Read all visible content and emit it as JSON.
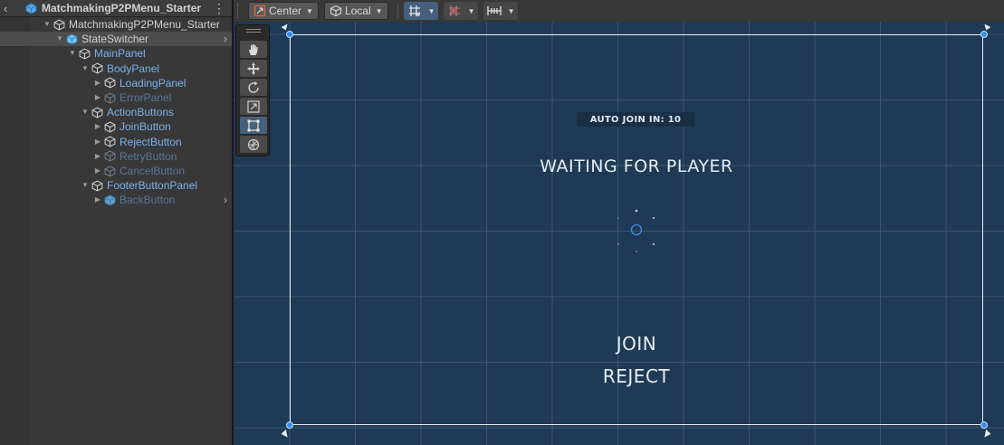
{
  "hierarchy": {
    "scene_title": "MatchmakingP2PMenu_Starter",
    "back_icon": "chevron-left-icon",
    "menu_icon": "kebab-menu-icon",
    "items": [
      {
        "label": "MatchmakingP2PMenu_Starter",
        "depth": 1,
        "expanded": true,
        "style": "white",
        "icon": "gameobject-cube-icon"
      },
      {
        "label": "StateSwitcher",
        "depth": 2,
        "expanded": true,
        "style": "white",
        "icon": "prefab-cube-icon",
        "selected": true,
        "has_right_chevron": true
      },
      {
        "label": "MainPanel",
        "depth": 3,
        "expanded": true,
        "style": "blue",
        "icon": "gameobject-cube-icon"
      },
      {
        "label": "BodyPanel",
        "depth": 4,
        "expanded": true,
        "style": "blue",
        "icon": "gameobject-cube-icon"
      },
      {
        "label": "LoadingPanel",
        "depth": 5,
        "expanded": false,
        "style": "blue",
        "icon": "gameobject-cube-icon"
      },
      {
        "label": "ErrorPanel",
        "depth": 5,
        "expanded": false,
        "style": "dim",
        "icon": "gameobject-cube-icon"
      },
      {
        "label": "ActionButtons",
        "depth": 4,
        "expanded": true,
        "style": "blue",
        "icon": "gameobject-cube-icon"
      },
      {
        "label": "JoinButton",
        "depth": 5,
        "expanded": false,
        "style": "blue",
        "icon": "gameobject-cube-icon"
      },
      {
        "label": "RejectButton",
        "depth": 5,
        "expanded": false,
        "style": "blue",
        "icon": "gameobject-cube-icon"
      },
      {
        "label": "RetryButton",
        "depth": 5,
        "expanded": false,
        "style": "dim",
        "icon": "gameobject-cube-icon"
      },
      {
        "label": "CancelButton",
        "depth": 5,
        "expanded": false,
        "style": "dim",
        "icon": "gameobject-cube-icon"
      },
      {
        "label": "FooterButtonPanel",
        "depth": 4,
        "expanded": true,
        "style": "blue",
        "icon": "gameobject-cube-icon"
      },
      {
        "label": "BackButton",
        "depth": 5,
        "expanded": false,
        "style": "dim",
        "icon": "prefab-cube-icon",
        "has_right_chevron": true
      }
    ]
  },
  "toolbar": {
    "pivot_label": "Center",
    "handle_label": "Local",
    "pivot_icon": "pivot-center-icon",
    "handle_icon": "local-cube-icon",
    "grid_snap_icon": "grid-snap-icon",
    "increment_snap_icon": "increment-snap-icon",
    "align_icon": "align-grid-icon"
  },
  "tools": [
    {
      "name": "hand-tool",
      "icon": "hand-icon",
      "active": false
    },
    {
      "name": "move-tool",
      "icon": "move-arrows-icon",
      "active": false
    },
    {
      "name": "rotate-tool",
      "icon": "rotate-icon",
      "active": false
    },
    {
      "name": "scale-tool",
      "icon": "scale-icon",
      "active": false
    },
    {
      "name": "rect-tool",
      "icon": "rect-transform-icon",
      "active": true
    },
    {
      "name": "transform-tool",
      "icon": "transform-icon",
      "active": false
    }
  ],
  "game_ui": {
    "auto_join": "AUTO JOIN IN: 10",
    "waiting": "WAITING FOR PLAYER",
    "join": "JOIN",
    "reject": "REJECT",
    "spinner_icon": "loading-spinner-icon"
  },
  "colors": {
    "scene_background": "#1f3a56",
    "grid_line": "#3d5670",
    "selection_blue": "#46607c",
    "hierarchy_blue_text": "#7ab1ed"
  }
}
